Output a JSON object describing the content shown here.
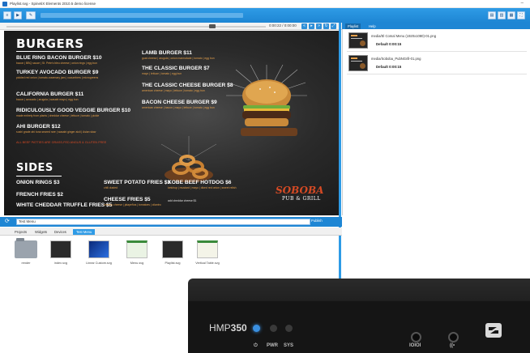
{
  "window": {
    "title": "Playlist.svg - SpinetiX Elements 2010.5 demo license"
  },
  "preview": {
    "timecode": "0:00:22 / 0:00:00"
  },
  "menu": {
    "burgers_title": "BURGERS",
    "burgers_left": [
      {
        "name": "BLUE RING BACON BURGER  $10",
        "desc": "bacon | BBQ sauce | St. Pete's bleu cheese | onion rings | egg bun"
      },
      {
        "name": "TURKEY AVOCADO BURGER  $9",
        "desc": "pickled red onion | tomato-rosemary jam | cucumbers | microgreens"
      },
      {
        "name": "CALIFORNIA BURGER  $11",
        "desc": "bacon | avocado | arugula | wasabi mayo | egg bun"
      },
      {
        "name": "RIDICULOUSLY GOOD VEGGIE BURGER  $10",
        "desc": "made entirely from plants | cheddar cheese | lettuce | tomato | pickle"
      },
      {
        "name": "AHI BURGER  $12",
        "desc": "sushi grade ahi tuna seared rare | wasabi ginger aioli | Asian slaw"
      }
    ],
    "burgers_note": "ALL BEEF PATTIES ARE GRASS-FED ANGUS & GLUTEN FREE",
    "burgers_right": [
      {
        "name": "LAMB BURGER  $11",
        "desc": "goat cheese | arugula | onion marmalade | tomato | egg bun"
      },
      {
        "name": "THE CLASSIC BURGER  $7",
        "desc": "mayo | lettuce | tomato | egg bun"
      },
      {
        "name": "THE CLASSIC CHEESE BURGER  $8",
        "desc": "american cheese | mayo | lettuce | tomato | egg bun"
      },
      {
        "name": "BACON CHEESE BURGER  $9",
        "desc": "american cheese | bacon | mayo | lettuce | tomato | egg bun"
      }
    ],
    "sides_title": "SIDES",
    "sides_col1": [
      {
        "name": "ONION RINGS  $3"
      },
      {
        "name": "FRENCH FRIES  $2"
      },
      {
        "name": "WHITE CHEDDAR TRUFFLE FRIES  $5"
      }
    ],
    "sides_col2": [
      {
        "name": "SWEET POTATO FRIES  $3",
        "desc": "chili dusted"
      },
      {
        "name": "CHEESE FRIES  $5",
        "desc": "creamy cheese | jalapeños | tomatoes | cilantro"
      }
    ],
    "sides_col3": [
      {
        "name": "KOBE BEEF HOTDOG  $6",
        "desc": "ketchup | mustard | mayo | diced red onion | sweet relish"
      },
      {
        "name": "",
        "desc": "add cheddar cheese $1"
      }
    ],
    "brand_line1": "SOBOBA",
    "brand_line2": "PUB & GRILL"
  },
  "right_panel": {
    "tabs": [
      "Playlist",
      "Help"
    ],
    "items": [
      {
        "name": "media/El Comal Menu (1920x1080)-01.png",
        "duration": "Default 0:00:15"
      },
      {
        "name": "media/Soboba_PubNGrill-01.png",
        "duration": "Default 0:00:15"
      }
    ]
  },
  "bottom": {
    "search_value": "Test Menu",
    "publish_label": "Publish",
    "tabs": [
      "Projects",
      "Widgets",
      "Devices",
      "Test Menu"
    ],
    "active_tab": "Test Menu",
    "files": [
      {
        "label": "render",
        "kind": "folder"
      },
      {
        "label": "index.svg",
        "kind": "menu-dark"
      },
      {
        "label": "Linear Custom.svg",
        "kind": "blue"
      },
      {
        "label": "Menu.svg",
        "kind": "menu-light"
      },
      {
        "label": "Playlist.svg",
        "kind": "menu-dark"
      },
      {
        "label": "Vertical Table.svg",
        "kind": "menu-light"
      }
    ]
  },
  "device": {
    "model_prefix": "HMP",
    "model_number": "350",
    "labels": [
      "PWR",
      "SYS"
    ],
    "port_label": "IOIOI",
    "led_colors": {
      "power": "#3a8fe0",
      "pwr": "#3a3a3a",
      "sys": "#3a3a3a"
    }
  },
  "colors": {
    "accent": "#1e86d4",
    "menu_desc": "#e5a04b",
    "brand_red": "#d64a24"
  }
}
